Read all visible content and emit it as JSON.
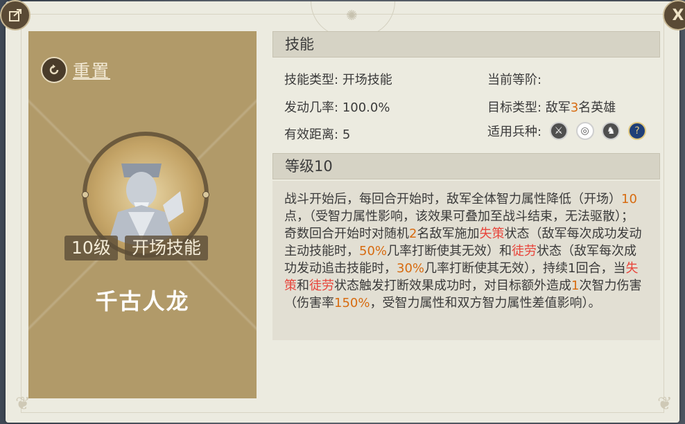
{
  "left": {
    "reset_label": "重置",
    "level_badge": "10级",
    "type_badge": "开场技能",
    "skill_name": "千古人龙"
  },
  "skill": {
    "header": "技能",
    "type_label": "技能类型:",
    "type_value": "开场技能",
    "rank_label": "当前等阶:",
    "rank_value": "",
    "rate_label": "发动几率:",
    "rate_value": "100.0%",
    "target_label": "目标类型:",
    "target_pre": "敌军",
    "target_num": "3",
    "target_post": "名英雄",
    "range_label": "有效距离:",
    "range_value": "5",
    "troops_label": "适用兵种:",
    "troop_icons": [
      "sword-icon",
      "target-icon",
      "horse-icon",
      "question-icon"
    ]
  },
  "level": {
    "header": "等级10"
  },
  "desc": {
    "p1": "战斗开始后，每回合开始时，敌军全体智力属性降低（开场）",
    "n1": "10",
    "p2": "点，（受智力属性影响，该效果可叠加至战斗结束，无法驱散）；奇数回合开始时对随机",
    "n2": "2",
    "p3": "名敌军施加",
    "s1": "失策",
    "p4": "状态（敌军每次成功发动主动技能时，",
    "n3": "50%",
    "p5": "几率打断使其无效）和",
    "s2": "徒劳",
    "p6": "状态（敌军每次成功发动追击技能时，",
    "n4": "30%",
    "p7": "几率打断使其无效），持续1回合，当",
    "s3": "失策",
    "p8": "和",
    "s4": "徒劳",
    "p9": "状态触发打断效果成功时，对目标额外造成",
    "n5": "1",
    "p10": "次智力伤害（伤害率",
    "n6": "150%",
    "p11": "，受智力属性和双方智力属性差值影响）。"
  },
  "colors": {
    "accent_orange": "#d76b10",
    "status_red": "#e8463c",
    "card_bg": "#b19a69"
  }
}
